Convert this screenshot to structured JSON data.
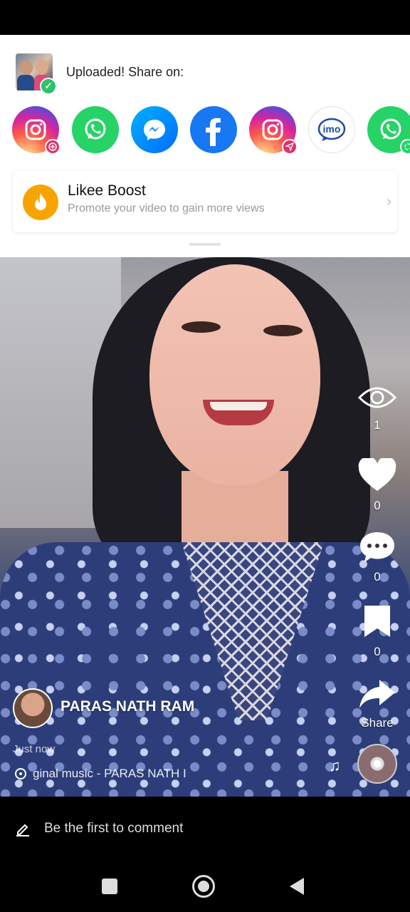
{
  "share_panel": {
    "uploaded_text": "Uploaded! Share on:",
    "share_targets": [
      "instagram-story",
      "whatsapp",
      "messenger",
      "facebook",
      "instagram-direct",
      "imo",
      "whatsapp-status"
    ],
    "imo_label": "imo",
    "boost": {
      "title": "Likee Boost",
      "subtitle": "Promote your video to gain more views"
    }
  },
  "video": {
    "views_count": "1",
    "likes_count": "0",
    "comments_count": "0",
    "saves_count": "0",
    "share_label": "Share",
    "user_name": "PARAS NATH RAM",
    "time": "Just now",
    "music": "ginal music - PARAS NATH I"
  },
  "comment_bar": {
    "placeholder": "Be the first to comment"
  },
  "colors": {
    "boost_orange": "#f7a400",
    "whatsapp_green": "#25d366",
    "facebook_blue": "#1877f2"
  }
}
